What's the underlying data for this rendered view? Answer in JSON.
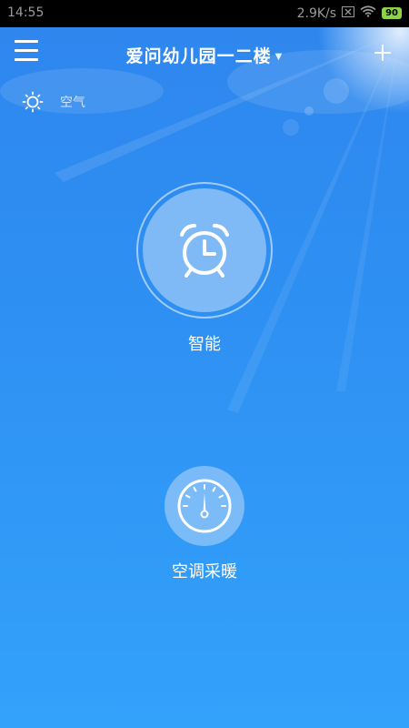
{
  "status_bar": {
    "time": "14:55",
    "net_speed": "2.9K/s",
    "battery": "90"
  },
  "header": {
    "title": "爱问幼儿园一二楼",
    "menu_icon": "hamburger-icon",
    "add_icon": "plus-icon"
  },
  "weather": {
    "icon": "sun-icon",
    "label": "空气"
  },
  "features": {
    "smart": {
      "label": "智能",
      "icon": "alarm-clock-icon"
    },
    "ac": {
      "label": "空调采暖",
      "icon": "gauge-icon"
    }
  },
  "colors": {
    "background_top": "#2f86ee",
    "background_bottom": "#33a2fb",
    "status_bar": "#000000",
    "battery": "#8bd449"
  }
}
